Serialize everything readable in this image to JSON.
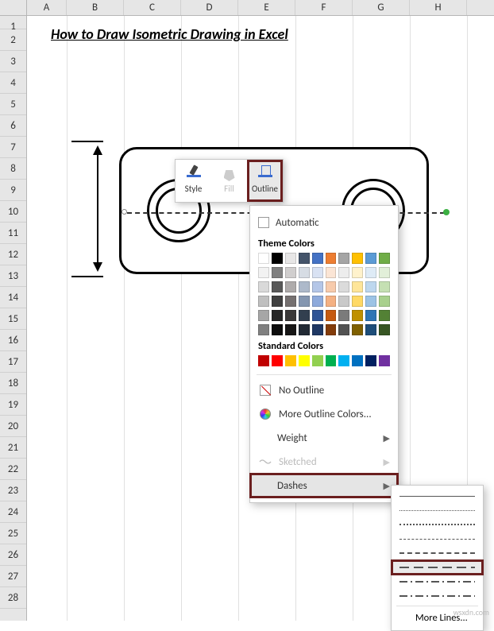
{
  "columns": [
    "A",
    "B",
    "C",
    "D",
    "E",
    "F",
    "G",
    "H"
  ],
  "rows": [
    "1",
    "2",
    "3",
    "4",
    "5",
    "6",
    "7",
    "8",
    "9",
    "10",
    "11",
    "12",
    "13",
    "14",
    "15",
    "16",
    "17",
    "18",
    "19",
    "20",
    "21",
    "22",
    "23",
    "24",
    "25",
    "26",
    "27",
    "28"
  ],
  "title": "How to Draw Isometric Drawing in Excel",
  "toolbar": {
    "style": "Style",
    "fill": "Fill",
    "outline": "Outline"
  },
  "menu": {
    "automatic": "Automatic",
    "theme_heading": "Theme Colors",
    "theme_row1": [
      "#ffffff",
      "#000000",
      "#e7e6e6",
      "#44546a",
      "#4472c4",
      "#ed7d31",
      "#a5a5a5",
      "#ffc000",
      "#5b9bd5",
      "#70ad47"
    ],
    "theme_row2": [
      "#f2f2f2",
      "#808080",
      "#d0cece",
      "#d6dce4",
      "#d9e2f3",
      "#fbe5d5",
      "#ededed",
      "#fff2cc",
      "#deebf6",
      "#e2efd9"
    ],
    "theme_row3": [
      "#d9d9d9",
      "#595959",
      "#aeabab",
      "#adb9ca",
      "#b4c6e7",
      "#f7cbac",
      "#dbdbdb",
      "#fee599",
      "#bdd7ee",
      "#c5e0b3"
    ],
    "theme_row4": [
      "#bfbfbf",
      "#404040",
      "#757070",
      "#8496b0",
      "#8eaadb",
      "#f4b183",
      "#c9c9c9",
      "#ffd965",
      "#9cc3e5",
      "#a8d08d"
    ],
    "theme_row5": [
      "#a6a6a6",
      "#262626",
      "#3a3838",
      "#323f4f",
      "#2f5496",
      "#c55a11",
      "#7b7b7b",
      "#bf9000",
      "#2e75b5",
      "#538135"
    ],
    "theme_row6": [
      "#808080",
      "#0d0d0d",
      "#171616",
      "#222a35",
      "#1f3864",
      "#833c0b",
      "#525252",
      "#7f6000",
      "#1e4e79",
      "#375623"
    ],
    "standard_heading": "Standard Colors",
    "standard": [
      "#c00000",
      "#ff0000",
      "#ffc000",
      "#ffff00",
      "#92d050",
      "#00b050",
      "#00b0f0",
      "#0070c0",
      "#002060",
      "#7030a0"
    ],
    "no_outline": "No Outline",
    "more_colors": "More Outline Colors...",
    "weight": "Weight",
    "sketched": "Sketched",
    "dashes": "Dashes"
  },
  "submenu": {
    "more_lines": "More Lines..."
  },
  "watermark": "wsxdn.com"
}
